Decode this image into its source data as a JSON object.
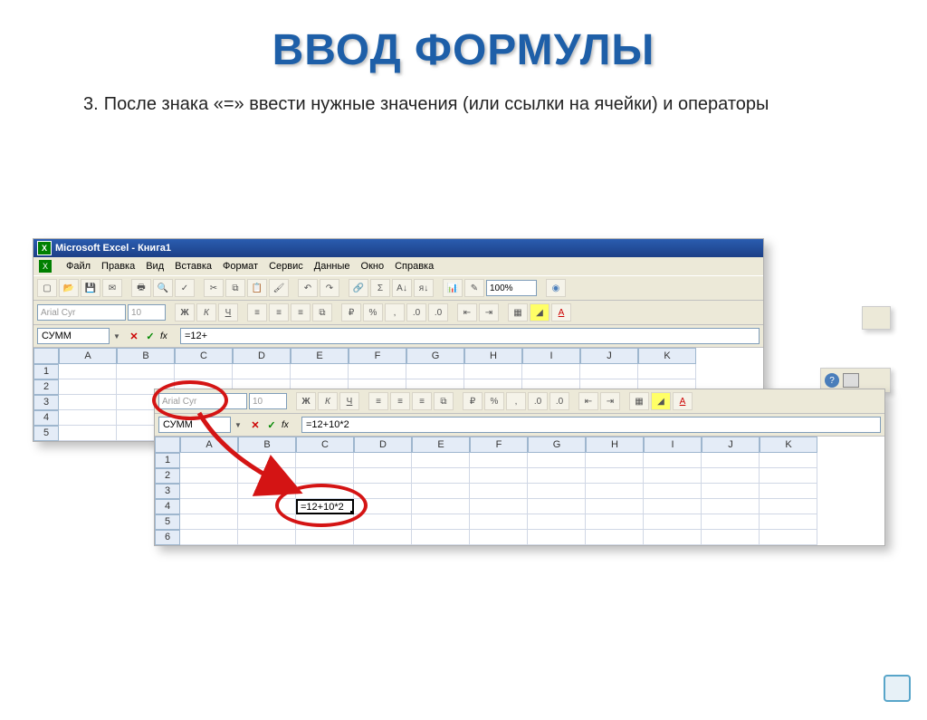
{
  "title": "ВВОД ФОРМУЛЫ",
  "step_number": "3.",
  "body_text": "После знака «=» ввести нужные значения (или ссылки на ячейки) и операторы",
  "excel_top": {
    "window_title": "Microsoft Excel - Книга1",
    "menu": [
      "Файл",
      "Правка",
      "Вид",
      "Вставка",
      "Формат",
      "Сервис",
      "Данные",
      "Окно",
      "Справка"
    ],
    "zoom": "100%",
    "font_name": "Arial Cyr",
    "font_size": "10",
    "name_box": "СУММ",
    "fx_label": "fx",
    "formula": "=12+",
    "columns": [
      "A",
      "B",
      "C",
      "D",
      "E",
      "F",
      "G",
      "H",
      "I",
      "J",
      "K"
    ],
    "rows": [
      "1",
      "2",
      "3",
      "4",
      "5"
    ],
    "active_cell_row": 4,
    "active_cell_col": "C",
    "active_cell_value": "=12+"
  },
  "excel_bottom": {
    "font_name": "Arial Cyr",
    "font_size": "10",
    "name_box": "СУММ",
    "fx_label": "fx",
    "formula": "=12+10*2",
    "columns": [
      "A",
      "B",
      "C",
      "D",
      "E",
      "F",
      "G",
      "H",
      "I",
      "J",
      "K"
    ],
    "rows": [
      "1",
      "2",
      "3",
      "4",
      "5",
      "6"
    ],
    "active_cell_row": 4,
    "active_cell_col": "C",
    "active_cell_value": "=12+10*2"
  },
  "icons": {
    "bold": "Ж",
    "italic": "К",
    "underline": "Ч",
    "sigma": "Σ",
    "sort_asc": "A↓",
    "sort_desc": "я↓"
  }
}
